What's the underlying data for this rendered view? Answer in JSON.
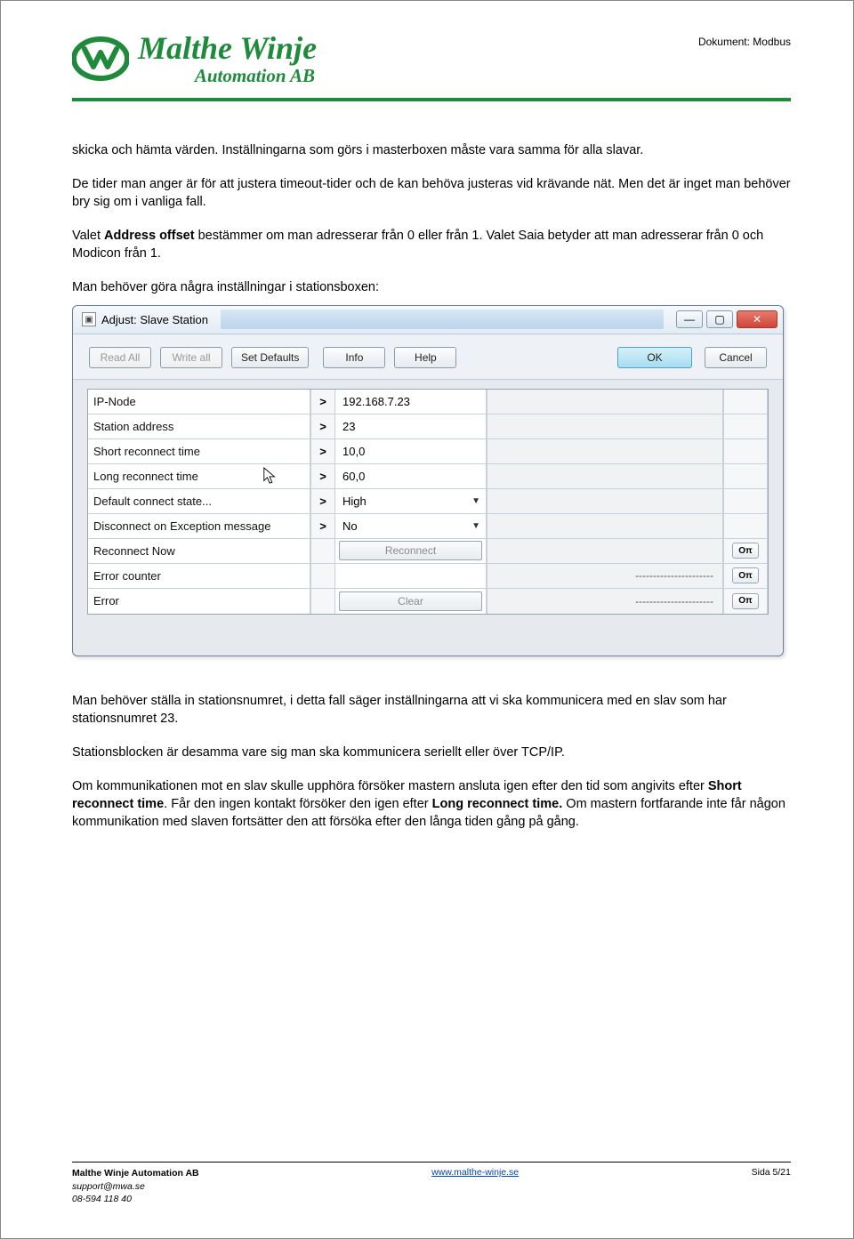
{
  "header": {
    "logo_name": "Malthe Winje",
    "logo_sub": "Automation AB",
    "doc_label": "Dokument: Modbus"
  },
  "body": {
    "p1": "skicka och hämta värden. Inställningarna som görs i masterboxen måste vara samma för alla slavar.",
    "p2": "De tider man anger är för att justera timeout-tider och de kan behöva justeras vid krävande nät. Men det är inget man behöver bry sig om i vanliga fall.",
    "p3a": "Valet ",
    "p3b": "Address offset",
    "p3c": " bestämmer om man adresserar från 0 eller från 1. Valet Saia betyder att man adresserar från 0 och Modicon från 1.",
    "p4": "Man behöver göra några inställningar i stationsboxen:",
    "p5": "Man behöver ställa in stationsnumret, i detta fall säger inställningarna att vi ska kommunicera med en slav som har stationsnumret 23.",
    "p6": "Stationsblocken är desamma vare sig man ska kommunicera seriellt eller över TCP/IP.",
    "p7a": "Om kommunikationen mot en slav skulle upphöra försöker mastern ansluta igen efter den tid som angivits efter ",
    "p7b": "Short reconnect time",
    "p7c": ". Får den ingen kontakt försöker den igen efter ",
    "p7d": "Long reconnect time.",
    "p7e": " Om mastern fortfarande inte får någon kommunikation med slaven fortsätter den att försöka efter den långa tiden gång på gång."
  },
  "dialog": {
    "title": "Adjust: Slave Station",
    "toolbar": {
      "read_all": "Read All",
      "write_all": "Write all",
      "set_defaults": "Set Defaults",
      "info": "Info",
      "help": "Help",
      "ok": "OK",
      "cancel": "Cancel"
    },
    "rows": [
      {
        "label": "IP-Node",
        "arrow": ">",
        "value": "192.168.7.23",
        "mid": "",
        "end": ""
      },
      {
        "label": "Station address",
        "arrow": ">",
        "value": "23",
        "mid": "",
        "end": ""
      },
      {
        "label": "Short reconnect time",
        "arrow": ">",
        "value": "10,0",
        "mid": "",
        "end": ""
      },
      {
        "label": "Long reconnect time",
        "arrow": ">",
        "value": "60,0",
        "mid": "",
        "end": ""
      },
      {
        "label": "Default connect state...",
        "arrow": ">",
        "value": "High",
        "dropdown": true,
        "mid": "",
        "end": ""
      },
      {
        "label": "Disconnect on Exception message",
        "arrow": ">",
        "value": "No",
        "dropdown": true,
        "mid": "",
        "end": ""
      },
      {
        "label": "Reconnect Now",
        "arrow": "",
        "value_btn": "Reconnect",
        "mid": "",
        "end": "Oπ"
      },
      {
        "label": "Error counter",
        "arrow": "",
        "value": "",
        "mid": "----------------------",
        "end": "Oπ"
      },
      {
        "label": "Error",
        "arrow": "",
        "value_btn": "Clear",
        "mid": "----------------------",
        "end": "Oπ"
      }
    ]
  },
  "footer": {
    "company": "Malthe Winje Automation AB",
    "email": "support@mwa.se",
    "phone": "08-594 118 40",
    "url": "www.malthe-winje.se",
    "page": "Sida 5/21"
  }
}
